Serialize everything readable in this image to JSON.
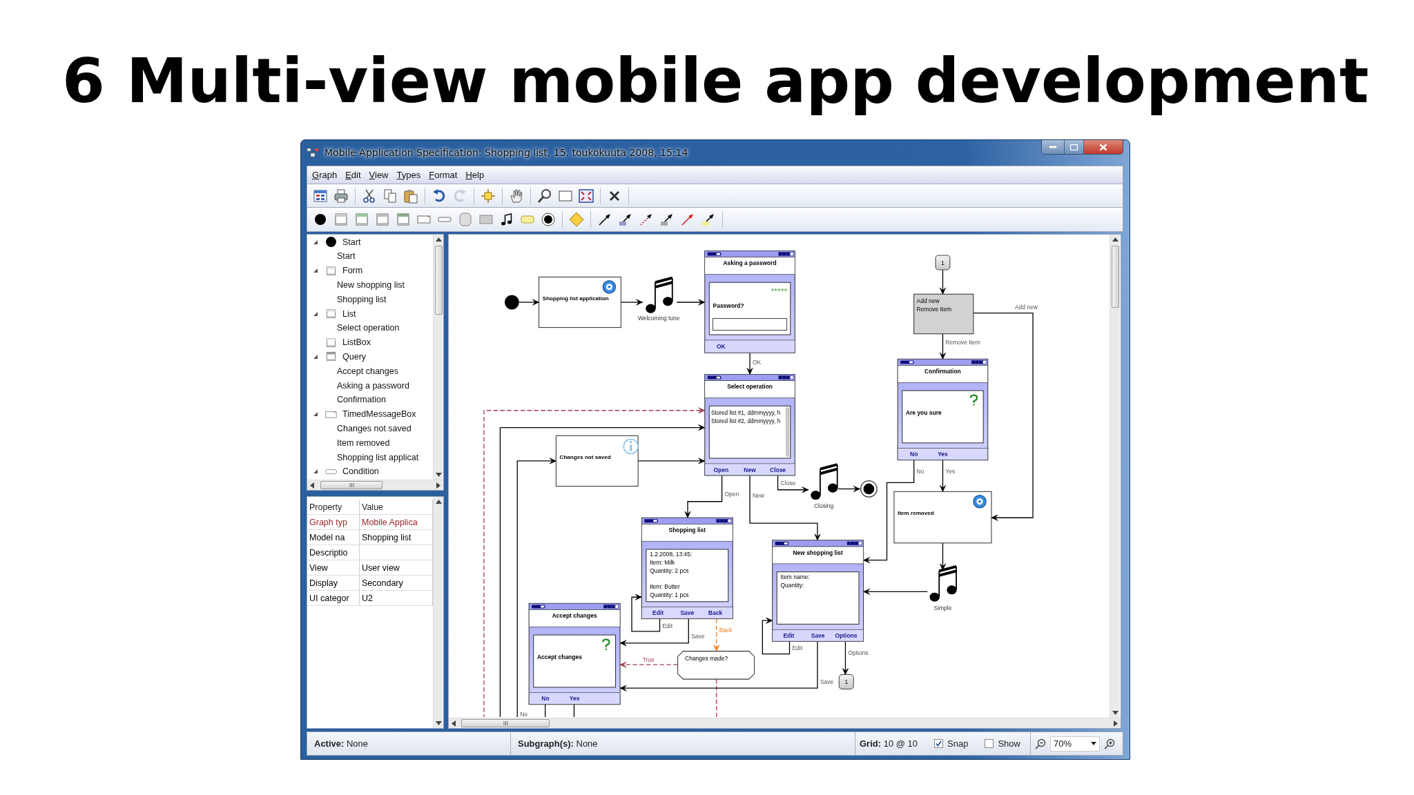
{
  "slide_title": "6 Multi-view mobile app development",
  "window": {
    "title": "Mobile Application Specification: Shopping list, 15. toukokuuta 2008, 15:14"
  },
  "menu": [
    "Graph",
    "Edit",
    "View",
    "Types",
    "Format",
    "Help"
  ],
  "toolbar": [
    {
      "disabled": false
    },
    {
      "disabled": false
    },
    {
      "disabled": false
    },
    {
      "disabled": false
    },
    {
      "disabled": false
    },
    {
      "disabled": false
    },
    {
      "disabled": true
    },
    {
      "disabled": false
    },
    {
      "disabled": false
    },
    {
      "disabled": false
    },
    {
      "disabled": false
    },
    {
      "disabled": false
    },
    {
      "disabled": false
    }
  ],
  "tree": [
    {
      "label": "Start",
      "kind": "start",
      "expanded": true,
      "children": [
        {
          "label": "Start"
        }
      ]
    },
    {
      "label": "Form",
      "kind": "form",
      "expanded": true,
      "children": [
        {
          "label": "New shopping list"
        },
        {
          "label": "Shopping list"
        }
      ]
    },
    {
      "label": "List",
      "kind": "list",
      "expanded": true,
      "children": [
        {
          "label": "Select operation"
        }
      ]
    },
    {
      "label": "ListBox",
      "kind": "listbox"
    },
    {
      "label": "Query",
      "kind": "query",
      "expanded": true,
      "children": [
        {
          "label": "Accept changes"
        },
        {
          "label": "Asking a password"
        },
        {
          "label": "Confirmation"
        }
      ]
    },
    {
      "label": "TimedMessageBox",
      "kind": "timed_message",
      "expanded": true,
      "children": [
        {
          "label": "Changes not saved"
        },
        {
          "label": "Item removed"
        },
        {
          "label": "Shopping list applicat"
        }
      ]
    },
    {
      "label": "Condition",
      "kind": "condition",
      "expanded": true
    }
  ],
  "properties": {
    "columns": [
      "Property",
      "Value"
    ],
    "rows": [
      {
        "cells": [
          "Graph typ",
          "Mobile Applica"
        ],
        "color": "#a0282d"
      },
      {
        "cells": [
          "Model na",
          "Shopping list"
        ],
        "color": "#000000"
      },
      {
        "cells": [
          "Descriptio"
        ],
        "color": "#000000"
      },
      {
        "cells": [
          "View",
          "User view"
        ],
        "color": "#000000"
      },
      {
        "cells": [
          "Display",
          "Secondary"
        ],
        "color": "#000000"
      },
      {
        "cells": [
          "UI categor",
          "U2"
        ],
        "color": "#000000"
      }
    ]
  },
  "diagram": {
    "nodes": [
      {
        "kind": "start"
      },
      {
        "kind": "message",
        "title": "Shopping list application"
      },
      {
        "kind": "tune",
        "label": "Welcoming tune"
      },
      {
        "kind": "password",
        "title": "Asking a password",
        "mask": "*****",
        "prompt": "Password?",
        "buttons": [
          "OK"
        ]
      },
      {
        "kind": "list",
        "title": "Select operation",
        "lines": [
          "Stored list #1, ddmmyyyy, h",
          "Stored list #2, ddmmyyyy, h"
        ],
        "buttons": [
          "Open",
          "New",
          "Close"
        ]
      },
      {
        "kind": "message",
        "title": "Changes not saved"
      },
      {
        "kind": "tune",
        "label": "Closing"
      },
      {
        "kind": "end"
      },
      {
        "kind": "form",
        "title": "Shopping list",
        "blocks": [
          [
            "1.2.2008, 13:45:",
            "Item: Milk",
            "Quantity: 2 pcs"
          ],
          [
            "Item: Butter",
            "Quantity: 1 pcs"
          ]
        ],
        "buttons": [
          "Edit",
          "Save",
          "Back"
        ]
      },
      {
        "kind": "form",
        "title": "New shopping list",
        "blocks": [
          [
            "Item name:",
            "Quantity:"
          ]
        ],
        "buttons": [
          "Edit",
          "Save",
          "Options"
        ]
      },
      {
        "kind": "query",
        "title": "Accept changes",
        "text": "Accept changes",
        "buttons": [
          "No",
          "Yes"
        ]
      },
      {
        "kind": "condition",
        "text": "Changes made?"
      },
      {
        "kind": "connector",
        "text": "1"
      },
      {
        "kind": "connector",
        "text": "1"
      },
      {
        "kind": "menu",
        "lines": [
          "Add new",
          "Remove Item"
        ]
      },
      {
        "kind": "query",
        "title": "Confirmation",
        "text": "Are you sure",
        "buttons": [
          "No",
          "Yes"
        ]
      },
      {
        "kind": "message",
        "title": "Item removed"
      },
      {
        "kind": "tune",
        "label": "Simple"
      }
    ],
    "edges": [
      {
        "kind": "transition"
      },
      {
        "kind": "transition"
      },
      {
        "kind": "transition"
      },
      {
        "kind": "transition",
        "label": "OK"
      },
      {
        "kind": "guard"
      },
      {
        "kind": "transition"
      },
      {
        "kind": "transition",
        "label": "No"
      },
      {
        "kind": "transition"
      },
      {
        "kind": "transition",
        "label": "Open"
      },
      {
        "kind": "transition",
        "label": "New"
      },
      {
        "kind": "transition",
        "label": "Close"
      },
      {
        "kind": "transition"
      },
      {
        "kind": "transition",
        "label": "Edit"
      },
      {
        "kind": "transition",
        "label": "Save"
      },
      {
        "kind": "return",
        "label": "Back"
      },
      {
        "kind": "guard",
        "label": "True"
      },
      {
        "kind": "exit"
      },
      {
        "kind": "transition",
        "label": "Edit"
      },
      {
        "kind": "transition",
        "label": "Save"
      },
      {
        "kind": "transition",
        "label": "Options"
      },
      {
        "kind": "transition"
      },
      {
        "kind": "transition",
        "label": "Remove Item"
      },
      {
        "kind": "transition",
        "label": "Add new"
      },
      {
        "kind": "transition",
        "label": "No"
      },
      {
        "kind": "transition",
        "label": "Yes"
      },
      {
        "kind": "transition"
      },
      {
        "kind": "transition"
      },
      {
        "kind": "transition"
      },
      {
        "kind": "transition"
      }
    ]
  },
  "status_bar": {
    "active": "**Active:** None",
    "subgraphs": "**Subgraph(s):** None",
    "grid": "**Grid:** 10 @ 10",
    "snap": {
      "label": "Snap",
      "checked": true
    },
    "show": {
      "label": "Show",
      "checked": false
    },
    "zoom": "70%"
  }
}
